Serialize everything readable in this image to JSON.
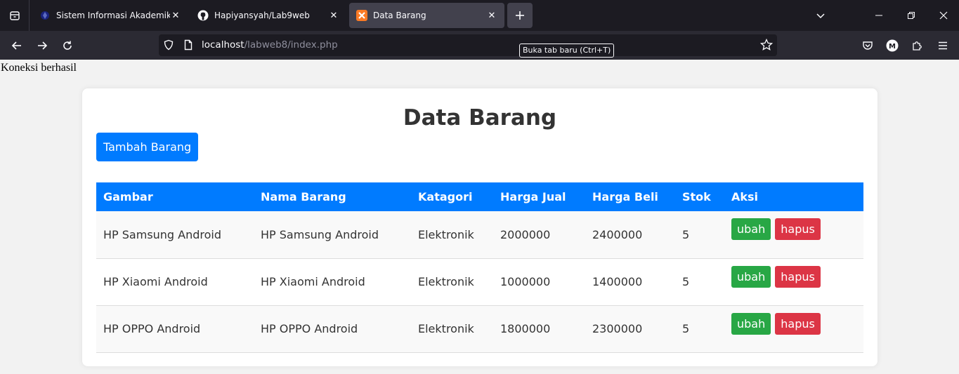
{
  "browser": {
    "tabs": [
      {
        "title": "Sistem Informasi Akademik",
        "active": false,
        "favicon": "academic-logo-icon"
      },
      {
        "title": "Hapiyansyah/Lab9web",
        "active": false,
        "favicon": "github-icon"
      },
      {
        "title": "Data Barang",
        "active": true,
        "favicon": "xampp-icon"
      }
    ],
    "url_host": "localhost",
    "url_path": "/labweb8/index.php",
    "tooltip": "Buka tab baru (Ctrl+T)"
  },
  "page": {
    "status_text": "Koneksi berhasil",
    "title": "Data Barang",
    "add_button": "Tambah Barang",
    "columns": [
      "Gambar",
      "Nama Barang",
      "Katagori",
      "Harga Jual",
      "Harga Beli",
      "Stok",
      "Aksi"
    ],
    "rows": [
      {
        "gambar": "HP Samsung Android",
        "nama": "HP Samsung Android",
        "kategori": "Elektronik",
        "harga_jual": "2000000",
        "harga_beli": "2400000",
        "stok": "5",
        "edit": "ubah",
        "delete": "hapus"
      },
      {
        "gambar": "HP Xiaomi Android",
        "nama": "HP Xiaomi Android",
        "kategori": "Elektronik",
        "harga_jual": "1000000",
        "harga_beli": "1400000",
        "stok": "5",
        "edit": "ubah",
        "delete": "hapus"
      },
      {
        "gambar": "HP OPPO Android",
        "nama": "HP OPPO Android",
        "kategori": "Elektronik",
        "harga_jual": "1800000",
        "harga_beli": "2300000",
        "stok": "5",
        "edit": "ubah",
        "delete": "hapus"
      }
    ]
  },
  "colors": {
    "primary": "#007bff",
    "success": "#28a745",
    "danger": "#dc3545",
    "browser_dark": "#1c1b22",
    "page_bg": "#f2f2f2"
  }
}
